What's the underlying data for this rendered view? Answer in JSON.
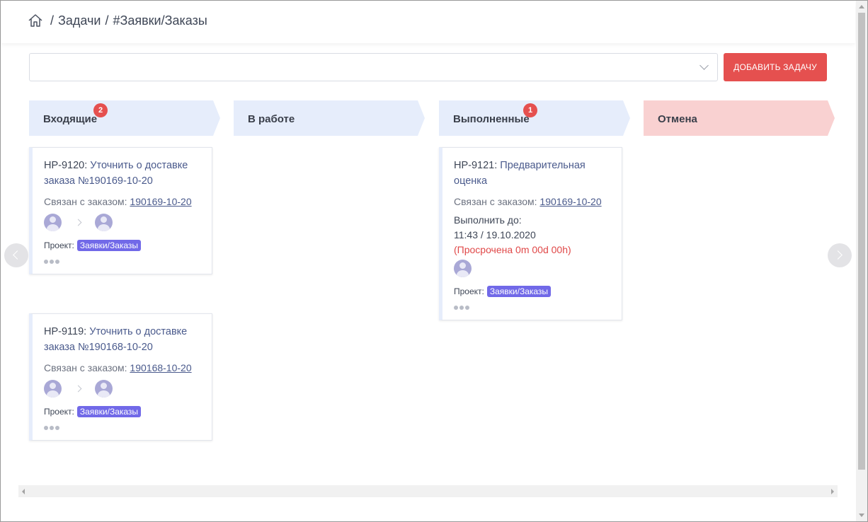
{
  "breadcrumb": {
    "home_icon": "home-icon",
    "items": [
      "Задачи",
      "#Заявки/Заказы"
    ],
    "separator": "/"
  },
  "toolbar": {
    "select_value": "",
    "add_button_label": "Добавить задачу"
  },
  "colors": {
    "accent_red": "#e5504f",
    "column_header": "#e6edfb",
    "cancel_header": "#f9d1d1",
    "tag": "#7169e8",
    "overdue": "#e04848"
  },
  "columns": [
    {
      "title": "Входящие",
      "badge": "2"
    },
    {
      "title": "В работе",
      "badge": ""
    },
    {
      "title": "Выполненные",
      "badge": "1"
    },
    {
      "title": "Отмена",
      "badge": ""
    }
  ],
  "cards": {
    "incoming": [
      {
        "code": "HP-9120:",
        "title": "Уточнить о доставке заказа №190169-10-20",
        "related_label": "Связан с заказом:",
        "related_order": "190169-10-20",
        "project_label": "Проект:",
        "project_tag": "Заявки/Заказы"
      },
      {
        "code": "HP-9119:",
        "title": "Уточнить о доставке заказа №190168-10-20",
        "related_label": "Связан с заказом:",
        "related_order": "190168-10-20",
        "project_label": "Проект:",
        "project_tag": "Заявки/Заказы"
      }
    ],
    "done": [
      {
        "code": "HP-9121:",
        "title": "Предварительная оценка",
        "related_label": "Связан с заказом:",
        "related_order": "190169-10-20",
        "due_label": "Выполнить до:",
        "due_value": "11:43 / 19.10.2020",
        "overdue": "(Просрочена 0m 00d 00h)",
        "project_label": "Проект:",
        "project_tag": "Заявки/Заказы"
      }
    ]
  }
}
